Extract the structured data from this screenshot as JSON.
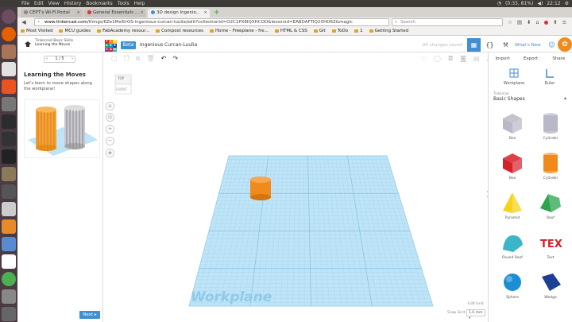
{
  "system_bar": {
    "menus": [
      "File",
      "Edit",
      "View",
      "History",
      "Bookmarks",
      "Tools",
      "Help"
    ],
    "battery": "(0:33, 81%)",
    "time": "22:12"
  },
  "browser": {
    "tabs": [
      {
        "label": "CEPT's Wi-Fi Portal",
        "active": false
      },
      {
        "label": "General Essentials ...",
        "active": false
      },
      {
        "label": "3D design Ingenio...",
        "active": true
      }
    ],
    "url_host": "www.tinkercad.com",
    "url_rest": "/things/6Ze1Mx6lrOS-ingenious-curcan-luulia/edit?collectionid=O2C1PX8IQXHCOD&lessonid=EABDAFTIQ2XHD6Z&magic",
    "search_placeholder": "Search",
    "bookmarks": [
      "Most Visited",
      "MCU guides",
      "FabAcademy resour...",
      "Compost resources",
      "Home - Freeplane - fre...",
      "HTML & CSS",
      "Git",
      "ToDo",
      "1",
      "Getting Started"
    ]
  },
  "tinkercad": {
    "lesson_series": "Tinkercad Basic Skills",
    "lesson_name": "Learning the Moves",
    "logo_letters": [
      "T",
      "I",
      "N",
      "K",
      "E",
      "R",
      "C",
      "A",
      "D"
    ],
    "beta": "Beta",
    "design_name": "Ingenious Curcan-Luulia",
    "save_status": "All changes saved",
    "whats_new": "What's New",
    "pager": "1 / 5",
    "lesson_title": "Learning the Moves",
    "lesson_desc": "Let's learn to move shapes along the workplane!",
    "next": "Next",
    "viewcube_top": "TOP",
    "viewcube_front": "FRONT",
    "workplane_label": "Workplane",
    "edit_grid": "Edit Grid",
    "snap_grid": "Snap Grid",
    "snap_value": "1.0 mm",
    "right_tabs": [
      "Import",
      "Export",
      "Share"
    ],
    "tools": [
      "Workplane",
      "Ruler"
    ],
    "category_small": "Tinkercad",
    "category": "Basic Shapes",
    "shapes": [
      {
        "name": "Box",
        "color": "#b8b8c8"
      },
      {
        "name": "Cylinder",
        "color": "#b8b8c8"
      },
      {
        "name": "Box",
        "color": "#d6202a"
      },
      {
        "name": "Cylinder",
        "color": "#f08a1c"
      },
      {
        "name": "Pyramid",
        "color": "#f7d21a"
      },
      {
        "name": "Roof",
        "color": "#2aa54b"
      },
      {
        "name": "Round Roof",
        "color": "#3ab6c8"
      },
      {
        "name": "Text",
        "color": "#d6202a"
      },
      {
        "name": "Sphere",
        "color": "#1a8fd6"
      },
      {
        "name": "Wedge",
        "color": "#1b3f94"
      }
    ]
  },
  "colors": {
    "accent": "#3f8fd2",
    "workplane": "#bfe4f7",
    "grid": "#8fcbe8",
    "orange": "#f08a1c"
  }
}
